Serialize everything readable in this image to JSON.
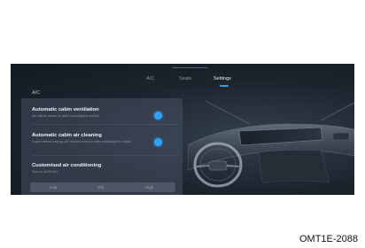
{
  "tabs": [
    {
      "label": "A/C",
      "active": false
    },
    {
      "label": "Seats",
      "active": false
    },
    {
      "label": "Settings",
      "active": true
    }
  ],
  "section_title": "A/C",
  "settings": [
    {
      "title": "Automatic cabin ventilation",
      "description": "A/C will be turned on after unlocking the vehicle",
      "enabled": true
    },
    {
      "title": "Automatic cabin air cleaning",
      "description": "If used before parking, A/C will be turned on after unlocking the vehicle",
      "enabled": true
    }
  ],
  "custom_ac": {
    "title": "Customised air conditioning",
    "subtitle": "Turn on AUTO A/C",
    "options": [
      "Low",
      "Mid",
      "High"
    ]
  },
  "colors": {
    "accent": "#2fa2ff",
    "screen_bg": "#1c232d"
  },
  "caption": "OMT1E-2088"
}
